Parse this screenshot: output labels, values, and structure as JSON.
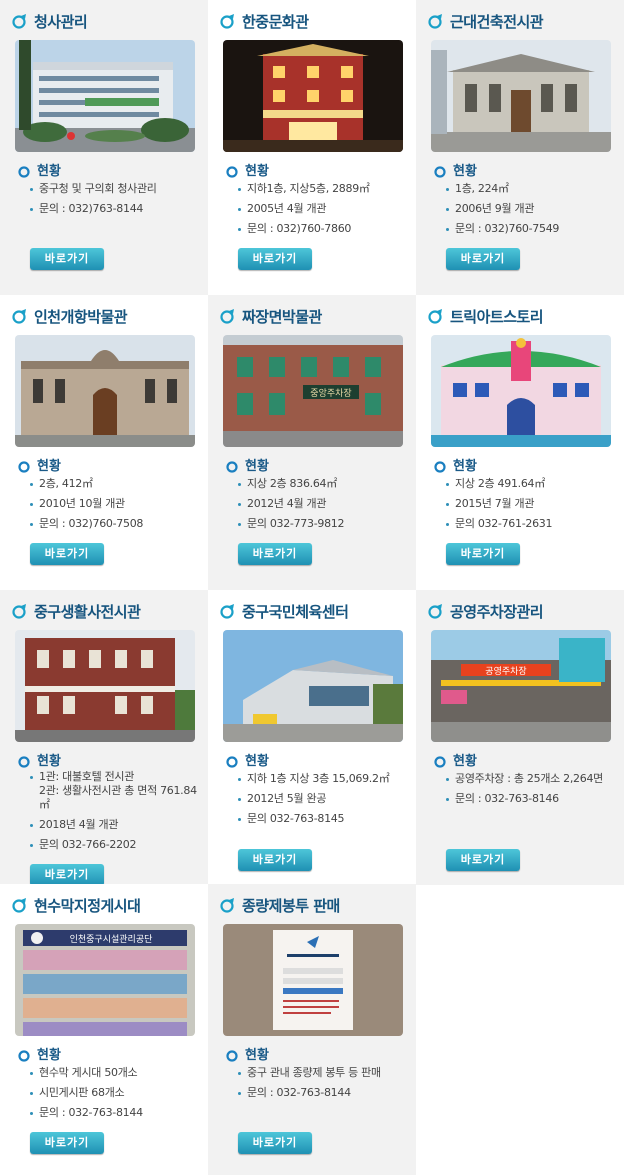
{
  "status_label": "현황",
  "button_label": "바로가기",
  "cards": [
    {
      "title": "청사관리",
      "lines": [
        "중구청 및 구의회 청사관리",
        "문의 : 032)763-8144"
      ]
    },
    {
      "title": "한중문화관",
      "lines": [
        "지하1층, 지상5층, 2889㎡",
        "2005년 4월 개관",
        "문의 : 032)760-7860"
      ]
    },
    {
      "title": "근대건축전시관",
      "lines": [
        "1층, 224㎡",
        "2006년 9월 개관",
        "문의 : 032)760-7549"
      ]
    },
    {
      "title": "인천개항박물관",
      "lines": [
        "2층, 412㎡",
        "2010년 10월 개관",
        "문의 : 032)760-7508"
      ]
    },
    {
      "title": "짜장면박물관",
      "lines": [
        "지상 2층 836.64㎡",
        "2012년 4월 개관",
        "문의 032-773-9812"
      ]
    },
    {
      "title": "트릭아트스토리",
      "lines": [
        "지상 2층 491.64㎡",
        "2015년 7월 개관",
        "문의 032-761-2631"
      ]
    },
    {
      "title": "중구생활사전시관",
      "lines": [
        "1관: 대불호텔 전시관\n2관: 생활사전시관 총 면적 761.84 ㎡",
        "2018년 4월 개관",
        "문의 032-766-2202"
      ]
    },
    {
      "title": "중구국민체육센터",
      "lines": [
        "지하 1층 지상 3층 15,069.2㎡",
        "2012년 5월 완공",
        "문의 032-763-8145"
      ]
    },
    {
      "title": "공영주차장관리",
      "lines": [
        "공영주차장 : 총 25개소 2,264면",
        "문의 : 032-763-8146"
      ]
    },
    {
      "title": "현수막지정게시대",
      "lines": [
        "현수막 게시대 50개소",
        "시민게시판 68개소",
        "문의 : 032-763-8144"
      ]
    },
    {
      "title": "종량제봉투 판매",
      "lines": [
        "중구 관내 종량제 봉투 등 판매",
        "문의 : 032-763-8144"
      ]
    }
  ],
  "photos": {
    "c6_sign": "중앙주차장",
    "c9_sign": "공영주차장",
    "c10_banner": "인천중구시설관리공단"
  },
  "colors": {
    "title": "#17557f",
    "status": "#1a5a88",
    "button_top": "#4dc6d9",
    "button_bottom": "#1f90b3",
    "alt_bg": "#f2f2f2"
  }
}
